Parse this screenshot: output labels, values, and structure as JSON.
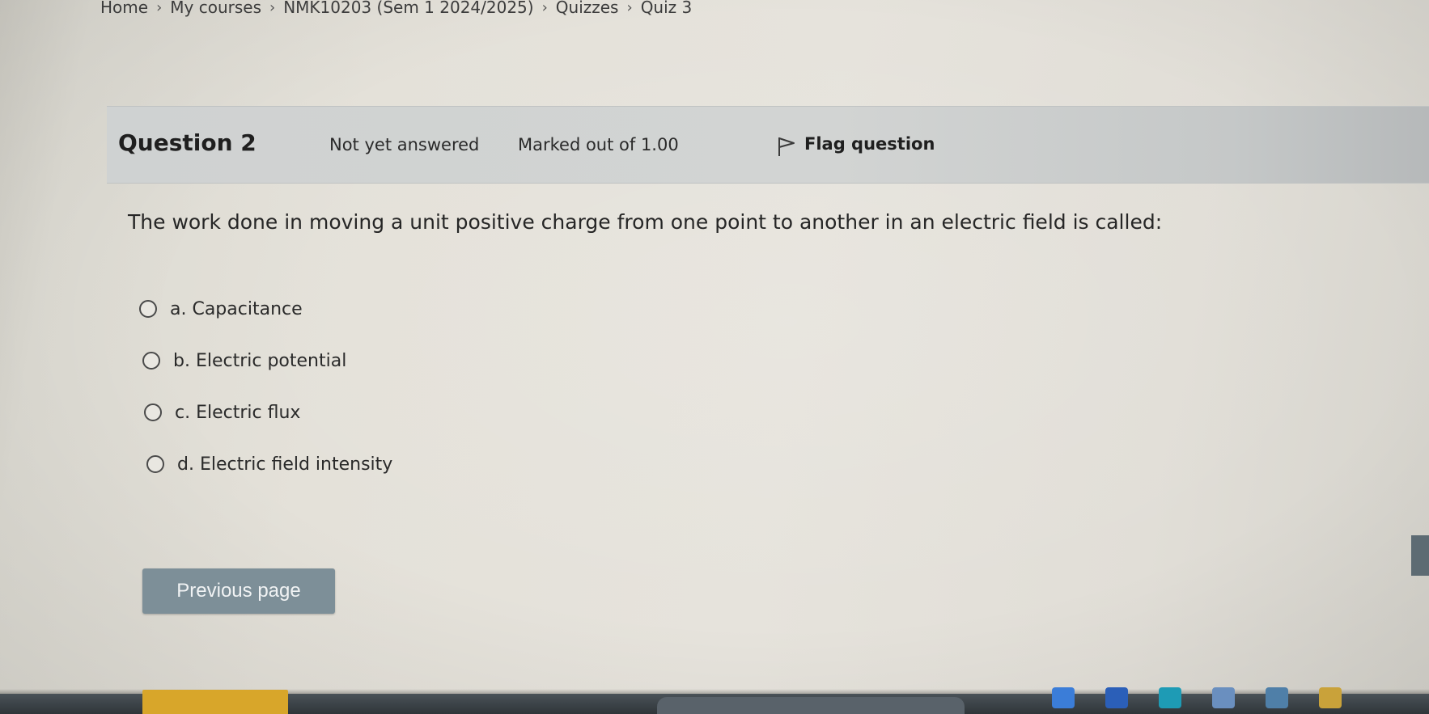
{
  "breadcrumb": {
    "items": [
      "Home",
      "My courses",
      "NMK10203 (Sem 1 2024/2025)",
      "Quizzes",
      "Quiz 3"
    ],
    "separator": "›"
  },
  "question": {
    "number_label": "Question 2",
    "state": "Not yet answered",
    "grade": "Marked out of 1.00",
    "flag_label": "Flag question",
    "text": "The work done in moving a unit positive charge from one point to another in an electric field is called:",
    "answers": [
      {
        "label": "a. Capacitance",
        "selected": false
      },
      {
        "label": "b. Electric potential",
        "selected": false
      },
      {
        "label": "c. Electric flux",
        "selected": false
      },
      {
        "label": "d. Electric field intensity",
        "selected": false
      }
    ]
  },
  "navigation": {
    "previous_label": "Previous page"
  },
  "colors": {
    "button": "#7d8f98",
    "info_bar": "#cfd2d2",
    "accent_yellow": "#d8a62a"
  },
  "icons": {
    "flag": "flag-icon",
    "breadcrumb_separator": "chevron-right-icon"
  }
}
